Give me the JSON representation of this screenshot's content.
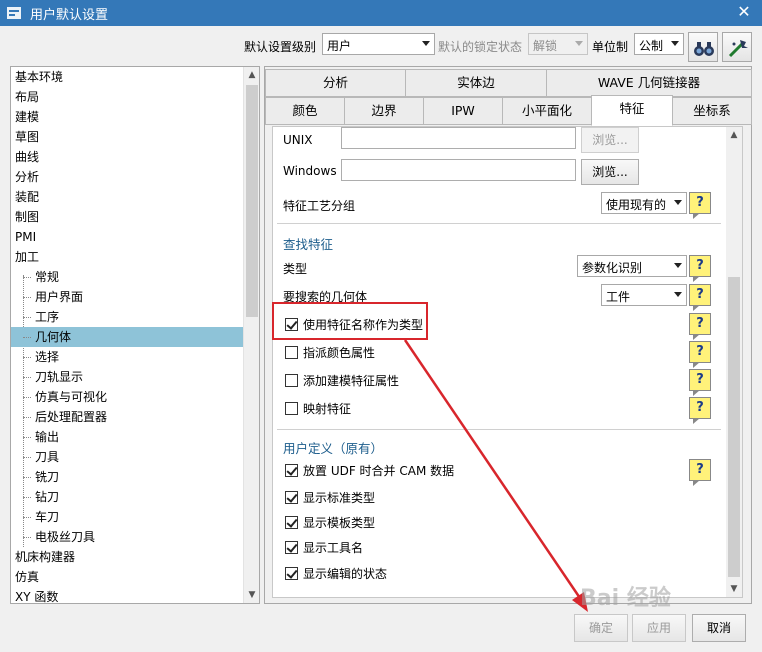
{
  "window": {
    "title": "用户默认设置",
    "close": "✕"
  },
  "toolbar": {
    "level_label": "默认设置级别",
    "level_value": "用户",
    "lock_label": "默认的锁定状态",
    "lock_value": "解锁",
    "unit_label": "单位制",
    "unit_value": "公制"
  },
  "tree": {
    "items": [
      "基本环境",
      "布局",
      "建模",
      "草图",
      "曲线",
      "分析",
      "装配",
      "制图",
      "PMI",
      "加工",
      "常规",
      "用户界面",
      "工序",
      "几何体",
      "选择",
      "刀轨显示",
      "仿真与可视化",
      "后处理配置器",
      "输出",
      "刀具",
      "铣刀",
      "钻刀",
      "车刀",
      "电极丝刀具",
      "机床构建器",
      "仿真",
      "XY 函数"
    ],
    "selected": "几何体"
  },
  "tabs": {
    "row1": [
      "分析",
      "实体边",
      "WAVE 几何链接器"
    ],
    "row2": [
      "颜色",
      "边界",
      "IPW",
      "小平面化",
      "特征",
      "坐标系"
    ],
    "active": "特征"
  },
  "content": {
    "unix_label": "UNIX",
    "browse_unix": "浏览...",
    "windows_label": "Windows",
    "browse_windows": "浏览...",
    "feature_group_label": "特征工艺分组",
    "feature_group_value": "使用现有的",
    "help_glyph": "?",
    "find_section": "查找特征",
    "type_label": "类型",
    "type_value": "参数化识别",
    "search_geom_label": "要搜索的几何体",
    "search_geom_value": "工件",
    "cb_use_name": "使用特征名称作为类型",
    "cb_color": "指派颜色属性",
    "cb_model_attr": "添加建模特征属性",
    "cb_map": "映射特征",
    "udf_section": "用户定义（原有）",
    "cb_udf_merge": "放置 UDF 时合并 CAM 数据",
    "cb_std_type": "显示标准类型",
    "cb_tpl_type": "显示模板类型",
    "cb_tool_name": "显示工具名",
    "cb_edit_state": "显示编辑的状态"
  },
  "checkboxes": {
    "use_name": true,
    "color": false,
    "model_attr": false,
    "map": false,
    "udf_merge": true,
    "std_type": true,
    "tpl_type": true,
    "tool_name": true,
    "edit_state": true
  },
  "buttons": {
    "ok": "确定",
    "apply": "应用",
    "cancel": "取消"
  },
  "watermark": "Bai 经验",
  "colors": {
    "titlebar": "#3478b8",
    "selection": "#8ec3d8",
    "highlight": "#d8262c",
    "section": "#1d5d8c"
  }
}
